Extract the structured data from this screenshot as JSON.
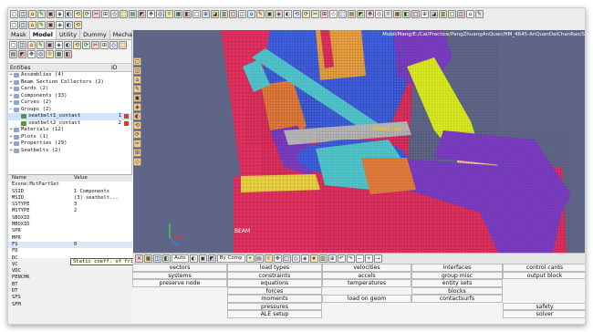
{
  "viewport": {
    "title": "Mobil/Mang/E:/Cal/Practice/PengZhuangAnQuan/HM_4645-AnQuanDaiChanRao/S",
    "annotation_orient": "Orient Lap",
    "annotation_beam": "BEAM"
  },
  "tabs": [
    "Mask",
    "Model",
    "Utility",
    "Dummy",
    "Mecha"
  ],
  "tree_header": {
    "col_entities": "Entities",
    "col_id": "ID",
    "col_color": ""
  },
  "tree": [
    {
      "label": "Assemblies (4)",
      "id": ""
    },
    {
      "label": "Beam Section Collectors (2)",
      "id": ""
    },
    {
      "label": "Cards (2)",
      "id": ""
    },
    {
      "label": "Components (33)",
      "id": ""
    },
    {
      "label": "Curves (2)",
      "id": ""
    },
    {
      "label": "Groups (2)",
      "id": ""
    },
    {
      "label": "seatbelt1_contact",
      "id": "1"
    },
    {
      "label": "seatbelt2_contact",
      "id": "2"
    },
    {
      "label": "Materials (12)",
      "id": ""
    },
    {
      "label": "Plots (1)",
      "id": ""
    },
    {
      "label": "Properties (29)",
      "id": ""
    },
    {
      "label": "Seatbelts (2)",
      "id": ""
    }
  ],
  "props_header": {
    "name": "Name",
    "value": "Value"
  },
  "props": [
    {
      "name": "Exone:MstPartSet",
      "value": ""
    },
    {
      "name": "SSID",
      "value": "1 Components"
    },
    {
      "name": "MSID",
      "value": "(3) seatbelt..."
    },
    {
      "name": "SSTYPE",
      "value": "3"
    },
    {
      "name": "MSTYPE",
      "value": "2"
    },
    {
      "name": "SBOXID",
      "value": ""
    },
    {
      "name": "MBOXID",
      "value": ""
    },
    {
      "name": "SPR",
      "value": ""
    },
    {
      "name": "MPR",
      "value": ""
    },
    {
      "name": "FS",
      "value": "0"
    },
    {
      "name": "FD",
      "value": ""
    },
    {
      "name": "DC",
      "value": ""
    },
    {
      "name": "VC",
      "value": ""
    },
    {
      "name": "VDC",
      "value": ""
    },
    {
      "name": "PENCHK",
      "value": ""
    },
    {
      "name": "BT",
      "value": ""
    },
    {
      "name": "DT",
      "value": ""
    },
    {
      "name": "SFS",
      "value": ""
    },
    {
      "name": "SFM",
      "value": ""
    }
  ],
  "tooltip": "Static coeff. of friction",
  "bottom_toolbar": {
    "auto_label": "Auto",
    "color_mode": "By Comp"
  },
  "menu": [
    [
      "vectors",
      "load types",
      "velocities",
      "interfaces",
      "control cards"
    ],
    [
      "systems",
      "constraints",
      "accels",
      "group misc",
      "output block"
    ],
    [
      "preserve node",
      "equations",
      "temperatures",
      "entity sets",
      ""
    ],
    [
      "",
      "forces",
      "",
      "blocks",
      ""
    ],
    [
      "",
      "moments",
      "load on geom",
      "contactsurfs",
      ""
    ],
    [
      "",
      "pressures",
      "",
      "",
      "safety"
    ],
    [
      "",
      "ALE setup",
      "",
      "",
      "solver"
    ]
  ],
  "colors": {
    "viewport_bg": "#5e6587",
    "seat_red": "#e0305f",
    "seatbelt_cyan": "#4fc3c9",
    "seatbelt_gray": "#b4b4b4",
    "dummy_purple": "#7a3cc0",
    "dummy_blue": "#3f5fe0",
    "arm_yellow": "#d8e81e",
    "hand_orange": "#e07a3a",
    "selection_blue": "#cfe3fb"
  }
}
